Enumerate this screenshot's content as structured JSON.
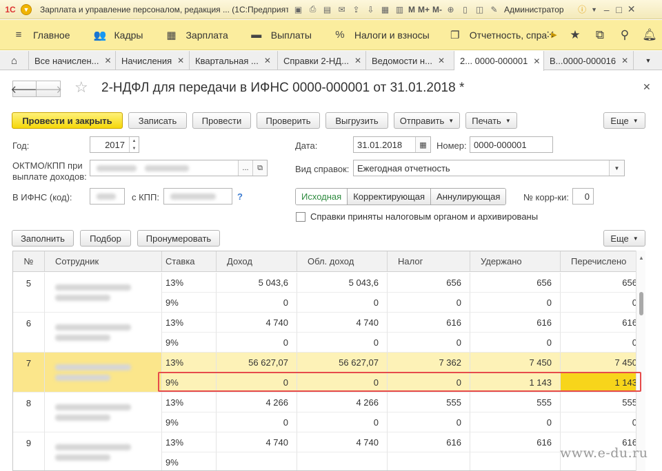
{
  "window": {
    "logo": "1С",
    "title": "Зарплата и управление персоналом, редакция ... (1С:Предприятие)",
    "user": "Администратор",
    "toolbar_text": [
      "M",
      "M+",
      "M-"
    ]
  },
  "menu": {
    "items": [
      {
        "icon": "≡",
        "label": "Главное"
      },
      {
        "icon": "👥",
        "label": "Кадры"
      },
      {
        "icon": "▦",
        "label": "Зарплата"
      },
      {
        "icon": "▬",
        "label": "Выплаты"
      },
      {
        "icon": "%",
        "label": "Налоги и взносы"
      },
      {
        "icon": "❐",
        "label": "Отчетность, спра"
      }
    ]
  },
  "tabs": [
    {
      "label": "Все начислен..."
    },
    {
      "label": "Начисления"
    },
    {
      "label": "Квартальная ..."
    },
    {
      "label": "Справки 2-НД..."
    },
    {
      "label": "Ведомости н..."
    },
    {
      "label": "2... 0000-000001"
    },
    {
      "label": "В...0000-000016"
    }
  ],
  "document": {
    "title": "2-НДФЛ для передачи в ИФНС 0000-000001 от 31.01.2018 *"
  },
  "buttons": {
    "post_close": "Провести и закрыть",
    "save": "Записать",
    "post": "Провести",
    "check": "Проверить",
    "export": "Выгрузить",
    "send": "Отправить",
    "print": "Печать",
    "more": "Еще",
    "fill": "Заполнить",
    "select": "Подбор",
    "renumber": "Пронумеровать",
    "more2": "Еще"
  },
  "form": {
    "year_label": "Год:",
    "year_value": "2017",
    "oktmo_label_1": "ОКТМО/КПП при",
    "oktmo_label_2": "выплате доходов:",
    "ifns_label": "В ИФНС (код):",
    "kpp_label": "с КПП:",
    "help": "?",
    "date_label": "Дата:",
    "date_value": "31.01.2018",
    "number_label": "Номер:",
    "number_value": "0000-000001",
    "kind_label": "Вид справок:",
    "kind_value": "Ежегодная отчетность",
    "kind_options": [
      "Исходная",
      "Корректирующая",
      "Аннулирующая"
    ],
    "corr_label": "№ корр-ки:",
    "corr_value": "0",
    "archived_label": "Справки приняты налоговым органом и архивированы"
  },
  "table": {
    "headers": [
      "№",
      "Сотрудник",
      "Ставка",
      "Доход",
      "Обл. доход",
      "Налог",
      "Удержано",
      "Перечислено"
    ],
    "rows": [
      {
        "no": "5",
        "lines": [
          [
            "13%",
            "5 043,6",
            "5 043,6",
            "656",
            "656",
            "656"
          ],
          [
            "9%",
            "0",
            "0",
            "0",
            "0",
            "0"
          ]
        ]
      },
      {
        "no": "6",
        "lines": [
          [
            "13%",
            "4 740",
            "4 740",
            "616",
            "616",
            "616"
          ],
          [
            "9%",
            "0",
            "0",
            "0",
            "0",
            "0"
          ]
        ]
      },
      {
        "no": "7",
        "lines": [
          [
            "13%",
            "56 627,07",
            "56 627,07",
            "7 362",
            "7 450",
            "7 450"
          ],
          [
            "9%",
            "0",
            "0",
            "0",
            "1 143",
            "1 143"
          ]
        ]
      },
      {
        "no": "8",
        "lines": [
          [
            "13%",
            "4 266",
            "4 266",
            "555",
            "555",
            "555"
          ],
          [
            "9%",
            "0",
            "0",
            "0",
            "0",
            "0"
          ]
        ]
      },
      {
        "no": "9",
        "lines": [
          [
            "13%",
            "4 740",
            "4 740",
            "616",
            "616",
            "616"
          ],
          [
            "9%",
            "",
            "",
            "",
            "",
            ""
          ]
        ]
      }
    ]
  },
  "watermark": "www.e-du.ru"
}
